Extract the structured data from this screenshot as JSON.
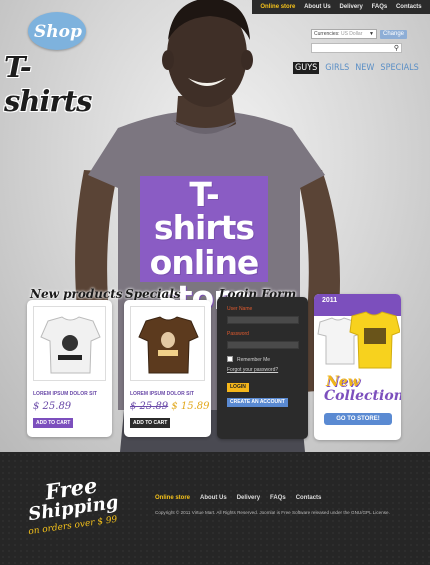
{
  "top_nav": [
    "Online store",
    "About Us",
    "Delivery",
    "FAQs",
    "Contacts"
  ],
  "logo": {
    "shop": "Shop",
    "tshirts": "T-shirts"
  },
  "currency": {
    "label": "Currencies:",
    "value": "US Dollar",
    "change": "Change"
  },
  "categories": [
    "GUYS",
    "GIRLS",
    "NEW",
    "SPECIALS"
  ],
  "hero_print": {
    "line1": "T-shirts",
    "line2": "online",
    "line3": "store"
  },
  "new_products": {
    "title": "New products",
    "name": "LOREM IPSUM DOLOR SIT",
    "price": "$ 25.89",
    "button": "ADD TO CART"
  },
  "specials": {
    "title": "Specials",
    "name": "LOREM IPSUM DOLOR SIT",
    "old_price": "$ 25.89",
    "new_price": "$ 15.89",
    "button": "ADD TO CART"
  },
  "login": {
    "title": "Login Form",
    "username_label": "User Name",
    "password_label": "Password",
    "remember": "Remember Me",
    "forgot": "Forgot your password?",
    "login_button": "LOGIN",
    "create_button": "CREATE AN ACCOUNT"
  },
  "collection": {
    "year": "2011",
    "new": "New",
    "collection": "Collection",
    "button": "GO TO STORE!"
  },
  "footer": {
    "free": "Free",
    "shipping": "Shipping",
    "orders": "on orders over $ 99",
    "nav": [
      "Online store",
      "About Us",
      "Delivery",
      "FAQs",
      "Contacts"
    ],
    "copyright": "Copyright © 2011 Virtue Mart. All Rights Reserved. Joomla! is Free Software released under the GNU/GPL License."
  },
  "colors": {
    "accent_purple": "#7c4fbd",
    "accent_yellow": "#f5c21a",
    "accent_blue": "#5a8ad2",
    "dark": "#262626"
  }
}
